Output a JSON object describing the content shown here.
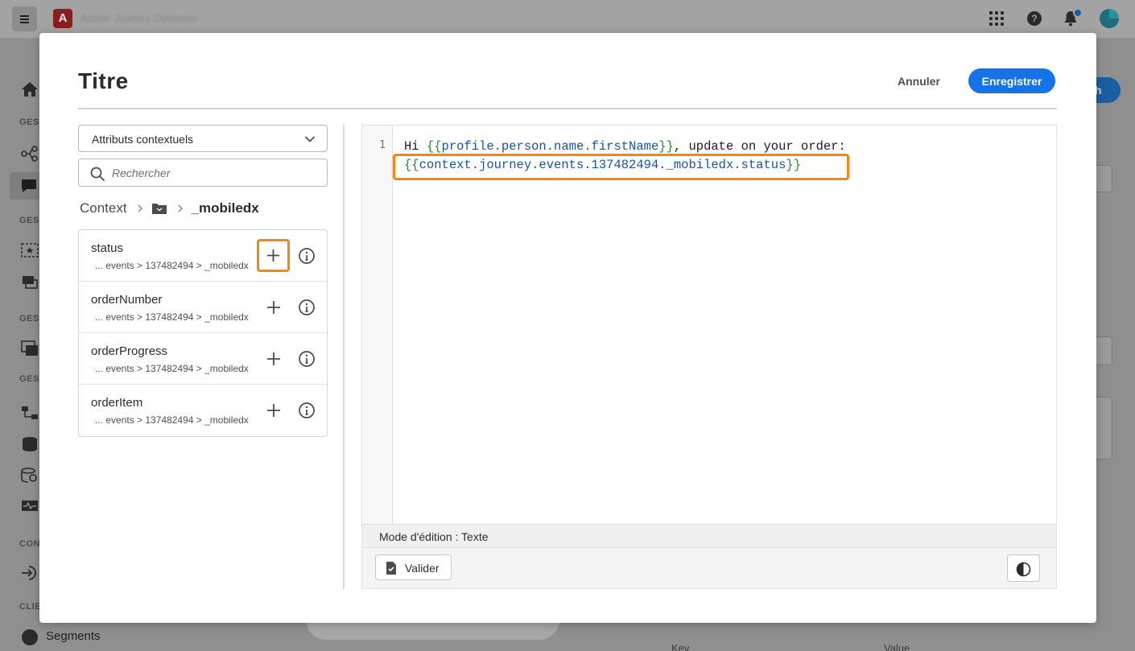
{
  "app": {
    "logo_letter": "A",
    "name": "Adobe Journey Optimizer",
    "sidebar_labels": [
      "GEST",
      "GEST",
      "GEST",
      "GEST",
      "CON",
      "CLIE"
    ],
    "segments_label": "Segments",
    "bg_button_fragment": "h",
    "table_key_header": "Key",
    "table_value_header": "Value"
  },
  "modal": {
    "title": "Titre",
    "cancel_label": "Annuler",
    "save_label": "Enregistrer"
  },
  "left_panel": {
    "dropdown_value": "Attributs contextuels",
    "search_placeholder": "Rechercher",
    "breadcrumb": {
      "root": "Context",
      "current": "_mobiledx"
    },
    "attributes": [
      {
        "name": "status",
        "path": "... events > 137482494 > _mobiledx"
      },
      {
        "name": "orderNumber",
        "path": "... events > 137482494 > _mobiledx"
      },
      {
        "name": "orderProgress",
        "path": "... events > 137482494 > _mobiledx"
      },
      {
        "name": "orderItem",
        "path": "... events > 137482494 > _mobiledx"
      }
    ]
  },
  "editor": {
    "line_number": "1",
    "line1_prefix": "Hi ",
    "line1_open": "{{",
    "line1_var": "profile.person.name.firstName",
    "line1_close": "}}",
    "line1_suffix": ", update on your order:",
    "line2_open": "{{",
    "line2_var": "context.journey.events.137482494._mobiledx.status",
    "line2_close": "}}",
    "mode_label": "Mode d'édition : Texte",
    "validate_label": "Valider"
  },
  "colors": {
    "accent_blue": "#1473e6",
    "highlight_orange": "#f68511",
    "brace_green": "#2d8a2d",
    "variable_blue": "#1556a8"
  }
}
